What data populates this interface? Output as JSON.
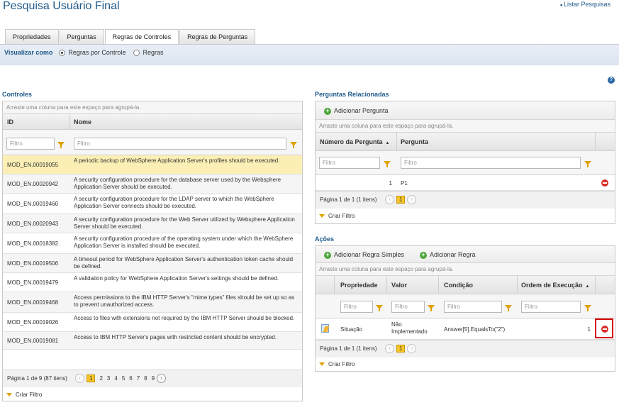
{
  "page": {
    "title": "Pesquisa Usuário Final",
    "back_link": "Listar Pesquisas"
  },
  "tabs": [
    "Propriedades",
    "Perguntas",
    "Regras de Controles",
    "Regras de Perguntas"
  ],
  "view": {
    "label": "Visualizar como",
    "option_controls": "Regras por Controle",
    "option_rules": "Regras"
  },
  "controls": {
    "title": "Controles",
    "group_hint": "Arraste uma coluna para este espaço para agrupá-la.",
    "col_id": "ID",
    "col_name": "Nome",
    "filter_placeholder": "Filtro",
    "rows": [
      {
        "id": "MOD_EN.00019055",
        "name": "A periodic backup of WebSphere Application Server's profiles should be executed."
      },
      {
        "id": "MOD_EN.00020942",
        "name": "A security configuration procedure for the database server used by the Websphere Application Server should be executed."
      },
      {
        "id": "MOD_EN.00019460",
        "name": "A security configuration procedure for the LDAP server to which the WebSphere Application Server connects should be executed."
      },
      {
        "id": "MOD_EN.00020943",
        "name": "A security configuration procedure for the Web Server utilized by Websphere Application Server should be executed."
      },
      {
        "id": "MOD_EN.00018382",
        "name": "A security configuration procedure of the operating system under which the WebSphere Application Server is installed should be executed."
      },
      {
        "id": "MOD_EN.00019506",
        "name": "A timeout period for WebSphere Application Server's authentication token cache should be defined."
      },
      {
        "id": "MOD_EN.00019479",
        "name": "A validation policy for WebSphere Application Server's settings should be defined."
      },
      {
        "id": "MOD_EN.00019468",
        "name": "Access permissions to the IBM HTTP Server's \"mime.types\" files should be set up so as to prevent unauthorized access."
      },
      {
        "id": "MOD_EN.00019026",
        "name": "Access to files with extensions not required by the IBM HTTP Server should be blocked."
      },
      {
        "id": "MOD_EN.00019081",
        "name": "Access to IBM HTTP Server's pages with restricted content should be encrypted."
      }
    ],
    "pager_text": "Página 1 de 9 (87 itens)",
    "pages": [
      "1",
      "2",
      "3",
      "4",
      "5",
      "6",
      "7",
      "8",
      "9"
    ],
    "prev": "‹",
    "next": "›",
    "create_filter": "Criar Filtro"
  },
  "questions": {
    "title": "Perguntas Relacionadas",
    "add_label": "Adicionar Pergunta",
    "group_hint": "Arraste uma coluna para este espaço para agrupá-la.",
    "col_number": "Número da Pergunta",
    "col_question": "Pergunta",
    "filter_placeholder": "Filtro",
    "rows": [
      {
        "number": "1",
        "question": "P1"
      }
    ],
    "pager_text": "Página 1 de 1 (1 itens)",
    "page": "1",
    "prev": "‹",
    "next": "›",
    "create_filter": "Criar Filtro"
  },
  "actions": {
    "title": "Ações",
    "add_simple": "Adicionar Regra Simples",
    "add_rule": "Adicionar Regra",
    "group_hint": "Arraste uma coluna para este espaço para agrupá-la.",
    "col_property": "Propriedade",
    "col_value": "Valor",
    "col_condition": "Condição",
    "col_order": "Ordem de Execução",
    "filter_placeholder": "Filtro",
    "rows": [
      {
        "property": "Situação",
        "value": "Não Implementado",
        "condition": "Answer[5].EqualsTo(\"2\")",
        "order": "1"
      }
    ],
    "pager_text": "Página 1 de 1 (1 itens)",
    "page": "1",
    "prev": "‹",
    "next": "›",
    "create_filter": "Criar Filtro"
  },
  "icons": {
    "help": "?",
    "sort": "▲",
    "add": "+",
    "back_arrow": "◂"
  },
  "colors": {
    "accent": "#1f5a8a",
    "highlight_border": "#d40000",
    "selected_row": "#fcefb5"
  }
}
